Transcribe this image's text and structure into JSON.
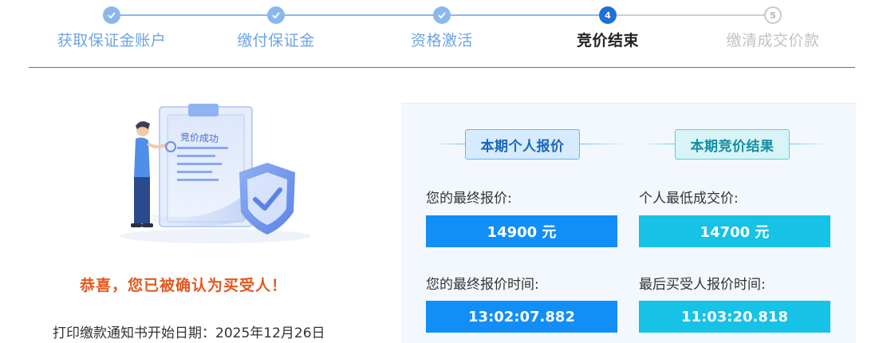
{
  "stepper": {
    "steps": [
      {
        "label": "获取保证金账户",
        "status": "done"
      },
      {
        "label": "缴付保证金",
        "status": "done"
      },
      {
        "label": "资格激活",
        "status": "done"
      },
      {
        "label": "竞价结束",
        "status": "current",
        "number": "4"
      },
      {
        "label": "缴清成交价款",
        "status": "pending",
        "number": "5"
      }
    ]
  },
  "illustration": {
    "doc_text": "竞价成功"
  },
  "result": {
    "congrats": "恭喜，您已被确认为买受人！",
    "notice": "打印缴款通知书开始日期：2025年12月26日"
  },
  "personal": {
    "tag": "本期个人报价",
    "final_price_label": "您的最终报价:",
    "final_price_value": "14900 元",
    "final_time_label": "您的最终报价时间:",
    "final_time_value": "13:02:07.882"
  },
  "outcome": {
    "tag": "本期竞价结果",
    "lowest_price_label": "个人最低成交价:",
    "lowest_price_value": "14700 元",
    "last_buyer_time_label": "最后买受人报价时间:",
    "last_buyer_time_value": "11:03:20.818"
  },
  "colors": {
    "accent_blue": "#128ef7",
    "accent_cyan": "#16c2e6",
    "congrats_orange": "#e3581f"
  }
}
